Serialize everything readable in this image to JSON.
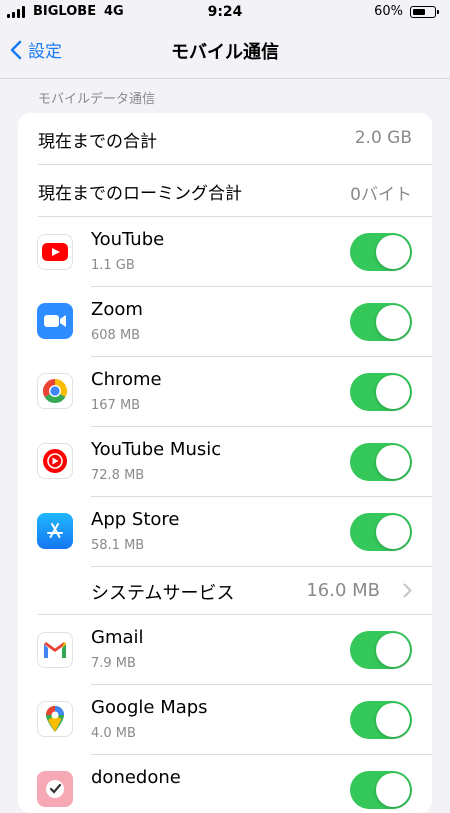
{
  "status_bar": {
    "carrier": "BIGLOBE",
    "network": "4G",
    "time": "9:24",
    "battery_pct": "60%",
    "battery_level": 0.6
  },
  "nav": {
    "back_label": "設定",
    "title": "モバイル通信"
  },
  "section": {
    "header": "モバイルデータ通信",
    "current_total": {
      "label": "現在までの合計",
      "value": "2.0 GB"
    },
    "roaming_total": {
      "label": "現在までのローミング合計",
      "value": "0バイト"
    },
    "apps": [
      {
        "name": "YouTube",
        "usage": "1.1 GB",
        "icon": "youtube-icon",
        "enabled": true
      },
      {
        "name": "Zoom",
        "usage": "608 MB",
        "icon": "zoom-icon",
        "enabled": true
      },
      {
        "name": "Chrome",
        "usage": "167 MB",
        "icon": "chrome-icon",
        "enabled": true
      },
      {
        "name": "YouTube Music",
        "usage": "72.8 MB",
        "icon": "youtube-music-icon",
        "enabled": true
      },
      {
        "name": "App Store",
        "usage": "58.1 MB",
        "icon": "app-store-icon",
        "enabled": true
      }
    ],
    "system_services": {
      "label": "システムサービス",
      "value": "16.0 MB"
    },
    "apps2": [
      {
        "name": "Gmail",
        "usage": "7.9 MB",
        "icon": "gmail-icon",
        "enabled": true
      },
      {
        "name": "Google Maps",
        "usage": "4.0 MB",
        "icon": "google-maps-icon",
        "enabled": true
      },
      {
        "name": "donedone",
        "usage": "",
        "icon": "donedone-icon",
        "enabled": true
      }
    ]
  },
  "colors": {
    "accent": "#1a7cf5",
    "toggle_on": "#34c759",
    "secondary_text": "#8a8a8e"
  }
}
